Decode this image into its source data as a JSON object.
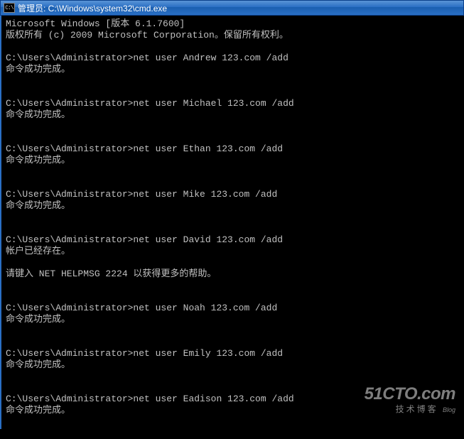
{
  "titlebar": {
    "icon_glyph": "C:\\",
    "text": "管理员: C:\\Windows\\system32\\cmd.exe"
  },
  "header": {
    "line1": "Microsoft Windows [版本 6.1.7600]",
    "line2": "版权所有 (c) 2009 Microsoft Corporation。保留所有权利。"
  },
  "prompt": "C:\\Users\\Administrator>",
  "success_msg": "命令成功完成。",
  "exists_msg": "帐户已经存在。",
  "helpmsg": "请键入 NET HELPMSG 2224 以获得更多的帮助。",
  "commands": [
    {
      "cmd": "net user Andrew 123.com /add",
      "result": "success"
    },
    {
      "cmd": "net user Michael 123.com /add",
      "result": "success"
    },
    {
      "cmd": "net user Ethan 123.com /add",
      "result": "success"
    },
    {
      "cmd": "net user Mike 123.com /add",
      "result": "success"
    },
    {
      "cmd": "net user David 123.com /add",
      "result": "exists"
    },
    {
      "cmd": "net user Noah 123.com /add",
      "result": "success"
    },
    {
      "cmd": "net user Emily 123.com /add",
      "result": "success"
    },
    {
      "cmd": "net user Eadison 123.com /add",
      "result": "success"
    }
  ],
  "watermark": {
    "main": "51CTO.com",
    "sub": "技术博客",
    "badge": "Blog"
  }
}
